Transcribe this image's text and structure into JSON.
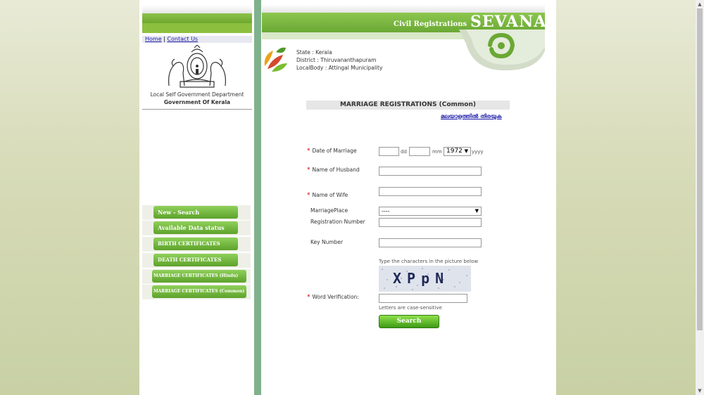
{
  "header": {
    "civil_registrations": "Civil Registrations",
    "sevana": "SEVANA",
    "state_label": "State : ",
    "state": "Kerala",
    "district_label": "District : ",
    "district": "Thiruvananthapuram",
    "localbody_label": "LocalBody : ",
    "localbody": "Attingal Municipality"
  },
  "left": {
    "home": "Home",
    "separator": " | ",
    "contact": "Contact Us",
    "dept": "Local Self Government Department",
    "gov": "Government Of Kerala",
    "menu": [
      "New - Search",
      "Available Data status",
      "BIRTH CERTIFICATES",
      "DEATH CERTIFICATES",
      "MARRIAGE CERTIFICATES (Hindu)",
      "MARRIAGE CERTIFICATES (Common)"
    ]
  },
  "form": {
    "title": "MARRIAGE REGISTRATIONS (Common)",
    "malayalam_link": "മലയാളത്തിൽ തിരയുക",
    "required_mark": "*",
    "date_label": "Date of Marriage",
    "dd": "dd",
    "mm": "mm",
    "year": "1972",
    "yyyy": "yyyy",
    "husband_label": "Name of Husband",
    "wife_label": "Name of Wife",
    "place_label": "MarriagePlace",
    "place_value": "----",
    "regno_label": "Registration Number",
    "key_label": "Key Number",
    "captcha_hint": "Type the characters in the picture below",
    "captcha_text": "XPpN",
    "word_label": "Word Verification:",
    "case_note": "Letters are case-sensitive",
    "search": "Search"
  },
  "colors": {
    "brand_green": "#6aa834",
    "link_blue": "#1a1aa8",
    "required_red": "#cc0000"
  }
}
